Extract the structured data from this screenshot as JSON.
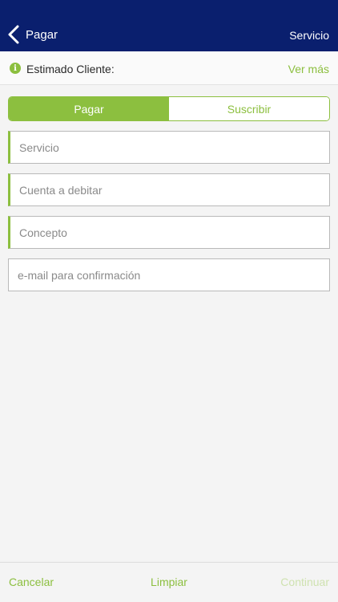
{
  "header": {
    "back_label": "Pagar",
    "right_label": "Servicio"
  },
  "info": {
    "text": "Estimado Cliente:",
    "more_label": "Ver más"
  },
  "tabs": [
    {
      "label": "Pagar",
      "active": true
    },
    {
      "label": "Suscribir",
      "active": false
    }
  ],
  "fields": {
    "service": {
      "placeholder": "Servicio",
      "value": ""
    },
    "account": {
      "placeholder": "Cuenta a debitar",
      "value": ""
    },
    "concept": {
      "placeholder": "Concepto",
      "value": ""
    },
    "email": {
      "placeholder": "e-mail para confirmación",
      "value": ""
    }
  },
  "footer": {
    "cancel_label": "Cancelar",
    "clear_label": "Limpiar",
    "continue_label": "Continuar"
  },
  "colors": {
    "header_bg": "#0a1f6e",
    "accent": "#8cbf3f",
    "disabled_accent": "#cfe2b0"
  }
}
